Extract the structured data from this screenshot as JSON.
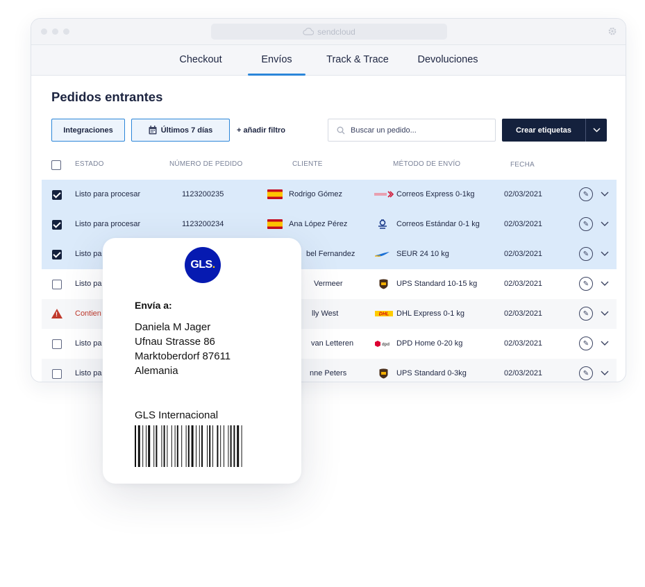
{
  "window": {
    "url": "sendcloud",
    "tabs": [
      {
        "label": "Checkout",
        "active": false
      },
      {
        "label": "Envíos",
        "active": true
      },
      {
        "label": "Track & Trace",
        "active": false
      },
      {
        "label": "Devoluciones",
        "active": false
      }
    ]
  },
  "page": {
    "title": "Pedidos entrantes",
    "integrations_label": "Integraciones",
    "date_filter_label": "Últimos 7 días",
    "add_filter_label": "+ añadir filtro",
    "search_placeholder": "Buscar un pedido...",
    "create_labels_button": "Crear etiquetas"
  },
  "table": {
    "headers": {
      "status": "ESTADO",
      "order_number": "NÚMERO DE PEDIDO",
      "customer": "CLIENTE",
      "shipping_method": "MÉTODO DE ENVÍO",
      "date": "FECHA"
    },
    "rows": [
      {
        "checked": true,
        "status": "Listo para procesar",
        "order": "1123200235",
        "customer": "Rodrigo Gómez",
        "carrier": "Correos Express 0-1kg",
        "carrier_icon": "correos-express",
        "date": "02/03/2021"
      },
      {
        "checked": true,
        "status": "Listo para procesar",
        "order": "1123200234",
        "customer": "Ana López Pérez",
        "carrier": "Correos Estándar 0-1 kg",
        "carrier_icon": "correos",
        "date": "02/03/2021"
      },
      {
        "checked": true,
        "status": "Listo pa",
        "order": "",
        "customer": "bel Fernandez",
        "carrier": "SEUR 24 10 kg",
        "carrier_icon": "seur",
        "date": "02/03/2021"
      },
      {
        "checked": false,
        "status": "Listo pa",
        "order": "",
        "customer": "Vermeer",
        "carrier": "UPS Standard 10-15 kg",
        "carrier_icon": "ups",
        "date": "02/03/2021"
      },
      {
        "checked": false,
        "warning": true,
        "status": "Contien",
        "order": "",
        "customer": "lly West",
        "carrier": "DHL Express 0-1 kg",
        "carrier_icon": "dhl",
        "date": "02/03/2021"
      },
      {
        "checked": false,
        "status": "Listo pa",
        "order": "",
        "customer": "van Letteren",
        "carrier": "DPD Home 0-20 kg",
        "carrier_icon": "dpd",
        "date": "02/03/2021"
      },
      {
        "checked": false,
        "status": "Listo pa",
        "order": "",
        "customer": "nne Peters",
        "carrier": "UPS Standard 0-3kg",
        "carrier_icon": "ups",
        "date": "02/03/2021"
      }
    ]
  },
  "label": {
    "ship_to_heading": "Envía a:",
    "address_lines": [
      "Daniela M Jager",
      "Ufnau Strasse 86",
      "Marktoberdorf 87611",
      "Alemania"
    ],
    "carrier": "GLS Internacional",
    "logo_text": "GLS",
    "logo_dot": ".",
    "logo_color": "#061AB1"
  },
  "colors": {
    "accent": "#2B86D9",
    "primary_button": "#14213D",
    "selected_row": "#DBEAFA",
    "error": "#C0392B"
  }
}
